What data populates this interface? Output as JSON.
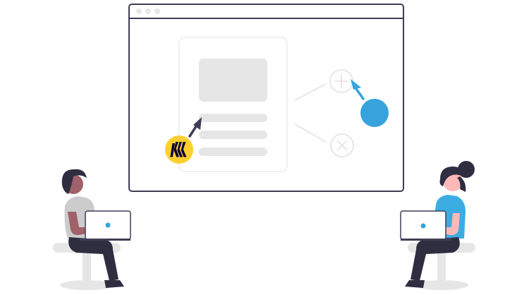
{
  "colors": {
    "background": "#ffffff",
    "window_border": "#3f3d56",
    "placeholder_gray": "#e6e6e6",
    "card_border": "#ebebeb",
    "connector_gray": "#e0e0e0",
    "logo_yellow": "#ffd02f",
    "logo_mark": "#050038",
    "cursor_dark": "#3f3d56",
    "accent_blue": "#36a3dc",
    "shirt_gray": "#cccccc",
    "shirt_blue": "#3bace2",
    "pants_dark": "#2f2e41",
    "hair_dark": "#2f2e41",
    "skin_left": "#a0616a",
    "skin_right": "#ffb8b8",
    "chair_gray": "#e6e6e6"
  },
  "icons": {
    "window_controls": "three-dots",
    "logo": "miro-logo",
    "add_node": "plus-icon",
    "remove_node": "close-icon",
    "cursor_left": "arrow-cursor-icon",
    "cursor_right": "arrow-cursor-icon"
  }
}
